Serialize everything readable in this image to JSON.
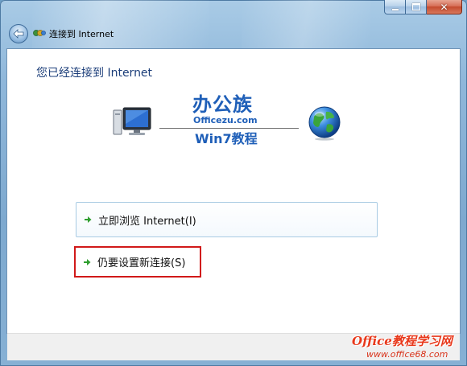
{
  "window": {
    "title": "连接到 Internet",
    "minimize_icon": "minimize-icon",
    "maximize_icon": "maximize-icon",
    "close_icon": "close-icon",
    "back_icon": "back-arrow-icon"
  },
  "main": {
    "heading": "您已经连接到 Internet",
    "logo": {
      "top": "办公族",
      "url": "Officezu.com",
      "bottom": "Win7教程"
    },
    "options": [
      {
        "label": "立即浏览 Internet(I)",
        "icon": "green-arrow-icon"
      },
      {
        "label": "仍要设置新连接(S)",
        "icon": "green-arrow-icon",
        "highlighted": true
      }
    ]
  },
  "watermark": {
    "line1": "Office教程学习网",
    "line2": "www.office68.com"
  },
  "colors": {
    "heading": "#1b3d79",
    "logo": "#1f5fb8",
    "highlight_box": "#d11919",
    "arrow": "#2f9e2f",
    "watermark": "#e8381b"
  }
}
